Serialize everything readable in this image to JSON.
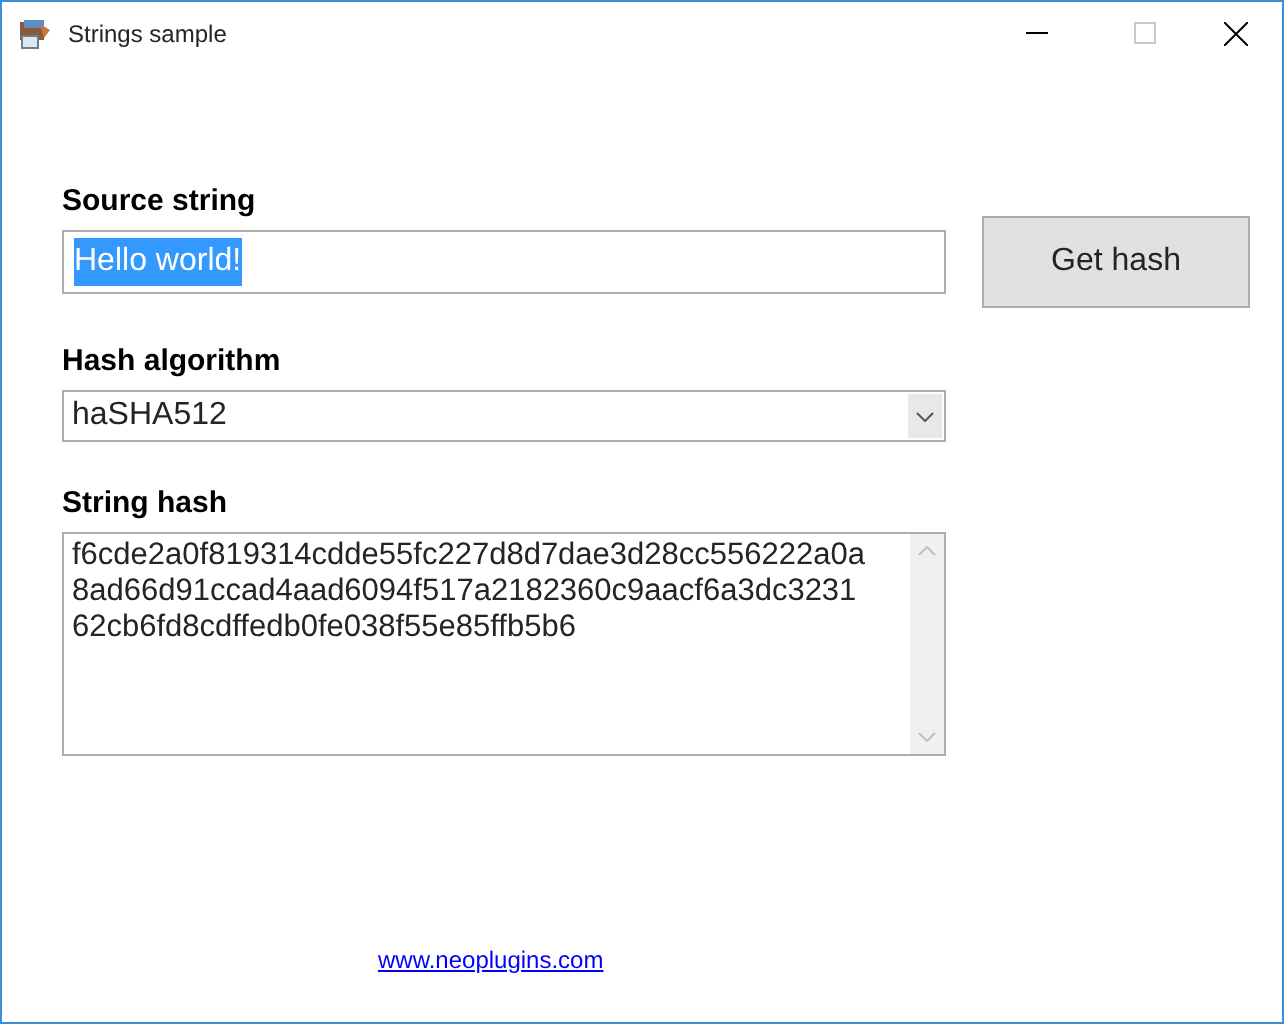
{
  "window": {
    "title": "Strings sample"
  },
  "source": {
    "label": "Source string",
    "value": "Hello world!",
    "selected": true
  },
  "button": {
    "label": "Get hash"
  },
  "algorithm": {
    "label": "Hash algorithm",
    "value": "haSHA512"
  },
  "hash": {
    "label": "String hash",
    "lines": [
      "f6cde2a0f819314cdde55fc227d8d7dae3d28cc556222a0a",
      "8ad66d91ccad4aad6094f517a2182360c9aacf6a3dc3231",
      "62cb6fd8cdffedb0fe038f55e85ffb5b6"
    ]
  },
  "link": {
    "text": "www.neoplugins.com"
  }
}
